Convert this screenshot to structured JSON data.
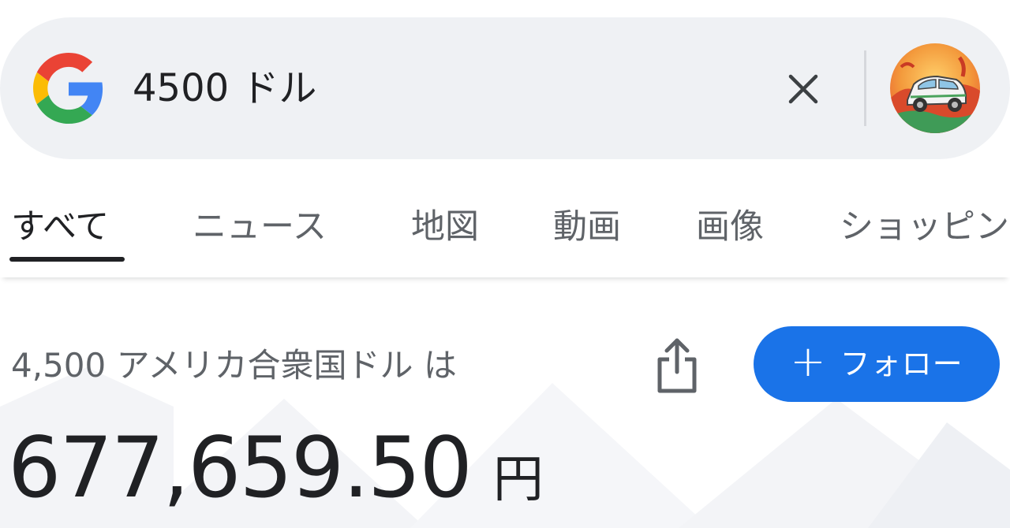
{
  "search": {
    "query": "4500 ドル",
    "clear_icon": "close-icon",
    "logo_icon": "google-g-icon",
    "avatar_icon": "avatar-car-image"
  },
  "tabs": [
    {
      "label": "すべて",
      "active": true
    },
    {
      "label": "ニュース",
      "active": false
    },
    {
      "label": "地図",
      "active": false
    },
    {
      "label": "動画",
      "active": false
    },
    {
      "label": "画像",
      "active": false
    },
    {
      "label": "ショッピング",
      "active": false
    }
  ],
  "result": {
    "subtitle": "4,500 アメリカ合衆国ドル は",
    "amount": "677,659.50",
    "unit": "円",
    "share_icon": "share-icon",
    "follow_label": "フォロー",
    "follow_icon": "plus-icon"
  },
  "colors": {
    "search_bar_bg": "#eff1f4",
    "follow_button_bg": "#1a73e8",
    "active_tab": "#202124",
    "inactive_tab": "#5f6368"
  }
}
